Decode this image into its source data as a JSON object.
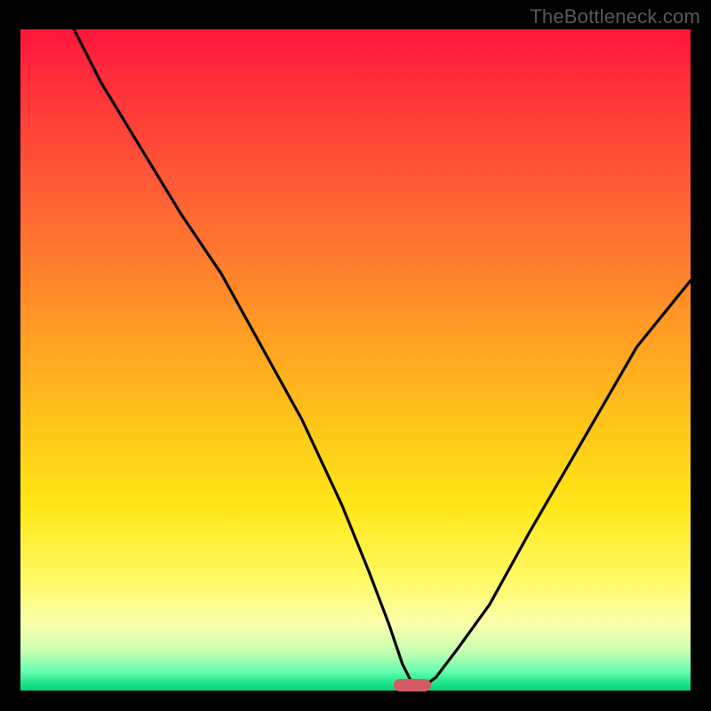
{
  "watermark": "TheBottleneck.com",
  "chart_data": {
    "type": "line",
    "title": "",
    "xlabel": "",
    "ylabel": "",
    "xlim": [
      0,
      100
    ],
    "ylim": [
      0,
      100
    ],
    "grid": false,
    "legend": false,
    "series": [
      {
        "name": "curve",
        "x": [
          8,
          12,
          18,
          24,
          30,
          36,
          42,
          48,
          52,
          55,
          57,
          58.5,
          60,
          62,
          65,
          70,
          76,
          84,
          92,
          100
        ],
        "y": [
          100,
          92,
          82,
          72,
          63,
          52,
          41,
          28,
          18,
          10,
          4,
          1,
          0.5,
          2,
          6,
          13,
          24,
          38,
          52,
          62
        ]
      }
    ],
    "marker": {
      "x": 58.5,
      "y": 0.8,
      "color": "#d45a63"
    },
    "gradient_stops": [
      {
        "pct": 0,
        "color": "#ff153d"
      },
      {
        "pct": 22,
        "color": "#ff5736"
      },
      {
        "pct": 48,
        "color": "#ffa322"
      },
      {
        "pct": 72,
        "color": "#ffe617"
      },
      {
        "pct": 90,
        "color": "#fbffad"
      },
      {
        "pct": 99,
        "color": "#18e38a"
      }
    ]
  }
}
